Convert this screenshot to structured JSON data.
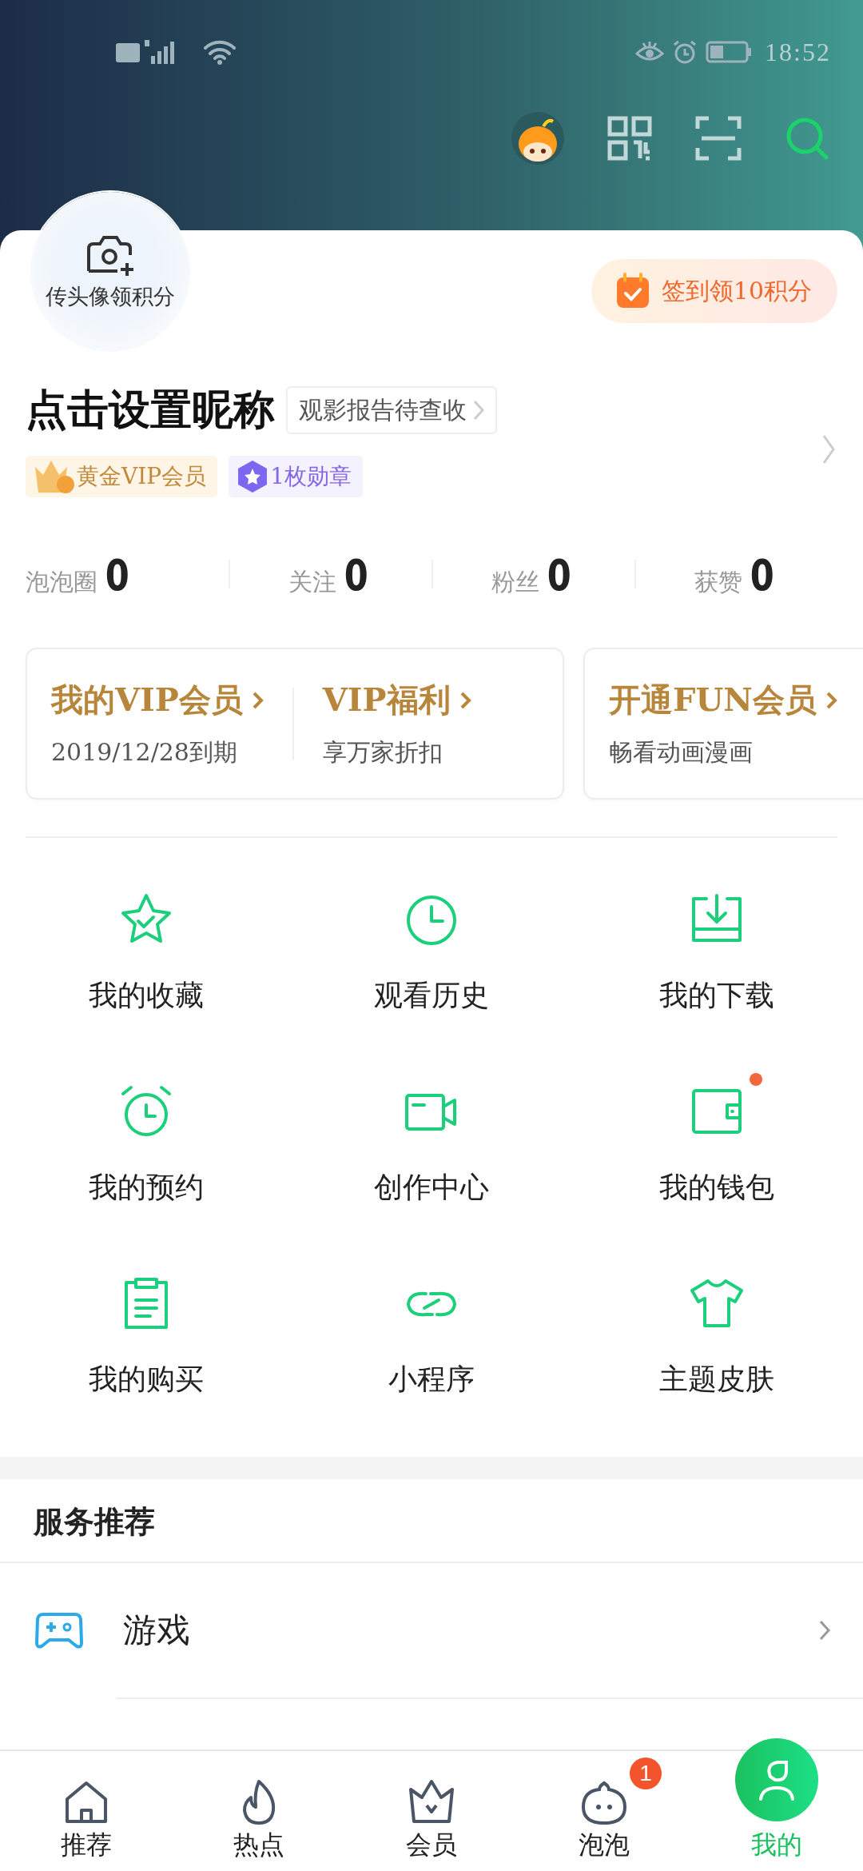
{
  "status_bar": {
    "time": "18:52"
  },
  "profile": {
    "avatar_hint": "传头像领积分",
    "checkin": "签到领10积分",
    "nickname": "点击设置昵称",
    "report": "观影报告待查收",
    "badges": [
      {
        "kind": "vip",
        "label": "黄金VIP会员"
      },
      {
        "kind": "medal",
        "label": "1枚勋章"
      }
    ]
  },
  "stats": [
    {
      "label": "泡泡圈",
      "value": "0"
    },
    {
      "label": "关注",
      "value": "0"
    },
    {
      "label": "粉丝",
      "value": "0"
    },
    {
      "label": "获赞",
      "value": "0"
    }
  ],
  "vip_cards": [
    {
      "items": [
        {
          "title": "我的VIP会员",
          "subtitle": "2019/12/28到期"
        },
        {
          "title": "VIP福利",
          "subtitle": "享万家折扣"
        }
      ]
    },
    {
      "items": [
        {
          "title": "开通FUN会员",
          "subtitle": "畅看动画漫画"
        }
      ]
    }
  ],
  "shortcuts": [
    {
      "kind": "star",
      "label": "我的收藏",
      "dot": false
    },
    {
      "kind": "clock",
      "label": "观看历史",
      "dot": false
    },
    {
      "kind": "download",
      "label": "我的下载",
      "dot": false
    },
    {
      "kind": "alarm",
      "label": "我的预约",
      "dot": false
    },
    {
      "kind": "video",
      "label": "创作中心",
      "dot": false
    },
    {
      "kind": "wallet",
      "label": "我的钱包",
      "dot": true
    },
    {
      "kind": "clipboard",
      "label": "我的购买",
      "dot": false
    },
    {
      "kind": "link",
      "label": "小程序",
      "dot": false
    },
    {
      "kind": "shirt",
      "label": "主题皮肤",
      "dot": false
    }
  ],
  "services": {
    "title": "服务推荐",
    "items": [
      {
        "label": "游戏"
      }
    ]
  },
  "bottom_nav": [
    {
      "kind": "home",
      "label": "推荐",
      "selected": false
    },
    {
      "kind": "fire",
      "label": "热点",
      "selected": false
    },
    {
      "kind": "crown",
      "label": "会员",
      "selected": false
    },
    {
      "kind": "bubble",
      "label": "泡泡",
      "selected": false,
      "badge": "1"
    },
    {
      "kind": "me",
      "label": "我的",
      "selected": true
    }
  ]
}
